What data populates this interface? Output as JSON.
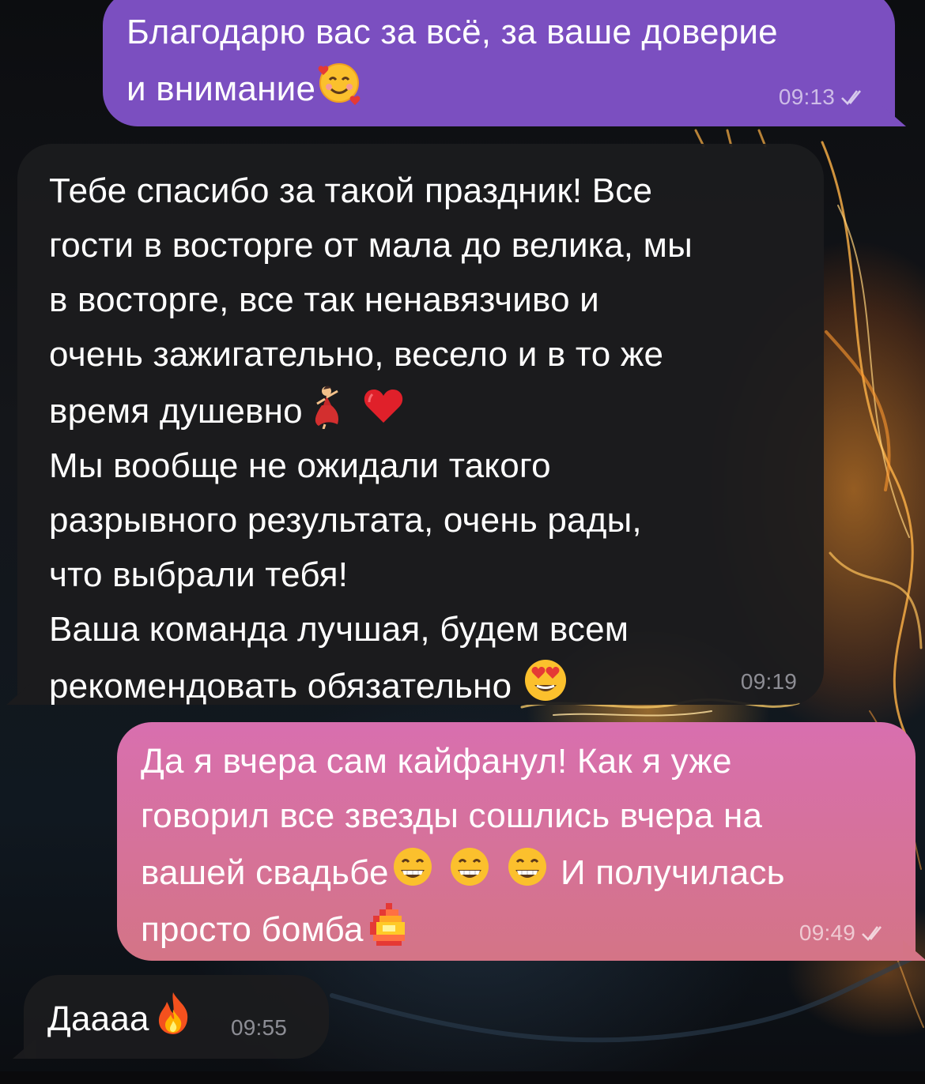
{
  "chat": {
    "messages": [
      {
        "direction": "outgoing",
        "text_lines": [
          "Благодарю вас за всё, за ваше доверие",
          "и внимание"
        ],
        "emoji": [
          "smiling-face-with-hearts"
        ],
        "time": "09:13",
        "status": "read",
        "bubble_color": "#7b4fc0"
      },
      {
        "direction": "incoming",
        "text_lines": [
          "Тебе спасибо за такой праздник! Все",
          "гости в восторге от мала до велика, мы",
          "в восторге, все так ненавязчиво и",
          "очень зажигательно, весело и в то же",
          "время душевно",
          "Мы вообще не ожидали такого",
          "разрывного результата, очень рады,",
          "что выбрали тебя!",
          "Ваша команда лучшая, будем всем",
          "рекомендовать обязательно"
        ],
        "emoji": [
          "woman-dancing",
          "red-heart",
          "smiling-face-with-heart-eyes"
        ],
        "time": "09:19",
        "bubble_color": "#1c1c1e"
      },
      {
        "direction": "outgoing",
        "text_lines": [
          "Да я вчера сам кайфанул! Как я уже",
          "говорил все звезды сошлись вчера на",
          "вашей свадьбе",
          " И получилась",
          "просто бомба"
        ],
        "emoji": [
          "beaming-face",
          "beaming-face",
          "beaming-face",
          "pixel-fire"
        ],
        "time": "09:49",
        "status": "read",
        "bubble_color": "#d6709f"
      },
      {
        "direction": "incoming",
        "text_lines": [
          "Даааа"
        ],
        "emoji": [
          "fire"
        ],
        "time": "09:55",
        "bubble_color": "#1c1c1e"
      }
    ]
  },
  "icons": {
    "read_status": "double-check-icon"
  }
}
